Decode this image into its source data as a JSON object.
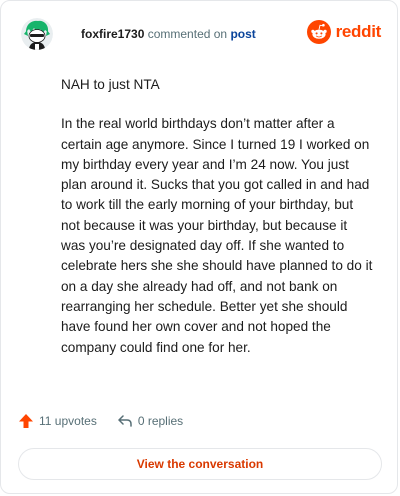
{
  "header": {
    "username": "foxfire1730",
    "action_text": "commented on",
    "post_link": "post"
  },
  "logo": {
    "icon": "reddit-alien-icon",
    "word": "reddit",
    "color": "#ff4500"
  },
  "comment": {
    "paragraph1": "NAH to just NTA",
    "paragraph2": "In the real world birthdays don’t matter after a certain age anymore. Since I turned 19 I worked on my birthday every year and I’m 24 now. You just plan around it. Sucks that you got called in and had to work till the early morning of your birthday, but not because it was your birthday, but because it was you’re designated day off. If she wanted to celebrate hers she she should have planned to do it on a day she already had off, and not bank on rearranging her schedule. Better yet she should have found her own cover and not hoped the company could find one for her."
  },
  "actions": {
    "upvotes_label": "11 upvotes",
    "upvote_icon": "upvote-arrow-icon",
    "upvote_color": "#ff4500",
    "replies_label": "0 replies",
    "reply_icon": "reply-arrow-icon"
  },
  "cta": {
    "label": "View the conversation",
    "color": "#d93900"
  }
}
